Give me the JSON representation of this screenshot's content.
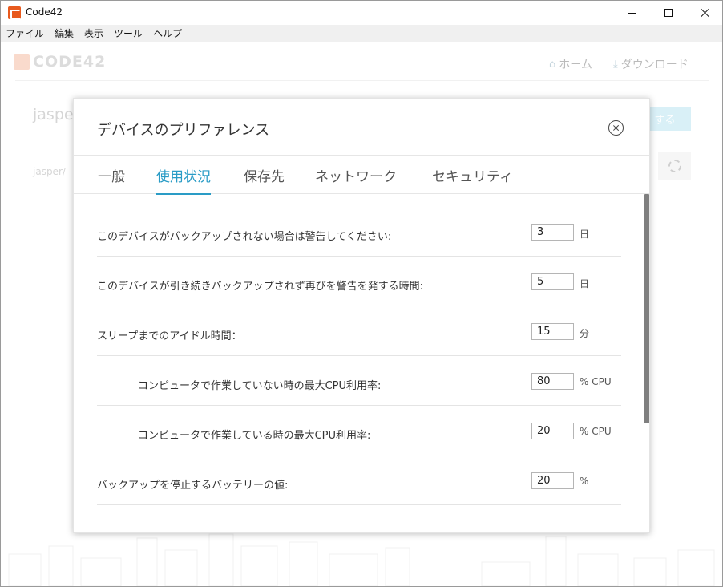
{
  "window": {
    "title": "Code42"
  },
  "menubar": {
    "items": [
      "ファイル",
      "編集",
      "表示",
      "ツール",
      "ヘルプ"
    ]
  },
  "background": {
    "logo_text": "CODE42",
    "nav_home": "ホーム",
    "nav_download": "ダウンロード",
    "device_name": "jasper",
    "device_sub": "jasper/",
    "action_button": "する"
  },
  "dialog": {
    "title": "デバイスのプリファレンス",
    "tabs": [
      {
        "label": "一般",
        "active": false
      },
      {
        "label": "使用状況",
        "active": true
      },
      {
        "label": "保存先",
        "active": false
      },
      {
        "label": "ネットワーク",
        "active": false
      },
      {
        "label": "セキュリティ",
        "active": false
      }
    ],
    "rows": [
      {
        "label": "このデバイスがバックアップされない場合は警告してください:",
        "value": "3",
        "unit": "日"
      },
      {
        "label": "このデバイスが引き続きバックアップされず再びを警告を発する時間:",
        "value": "5",
        "unit": "日"
      },
      {
        "label": "スリープまでのアイドル時間：",
        "value": "15",
        "unit": "分"
      },
      {
        "label": "コンピュータで作業していない時の最大CPU利用率:",
        "value": "80",
        "unit": "% CPU"
      },
      {
        "label": "コンピュータで作業している時の最大CPU利用率:",
        "value": "20",
        "unit": "% CPU"
      },
      {
        "label": "バックアップを停止するバッテリーの値:",
        "value": "20",
        "unit": "%"
      }
    ]
  },
  "colors": {
    "accent": "#2a9cc6",
    "brand": "#e85a1e"
  }
}
